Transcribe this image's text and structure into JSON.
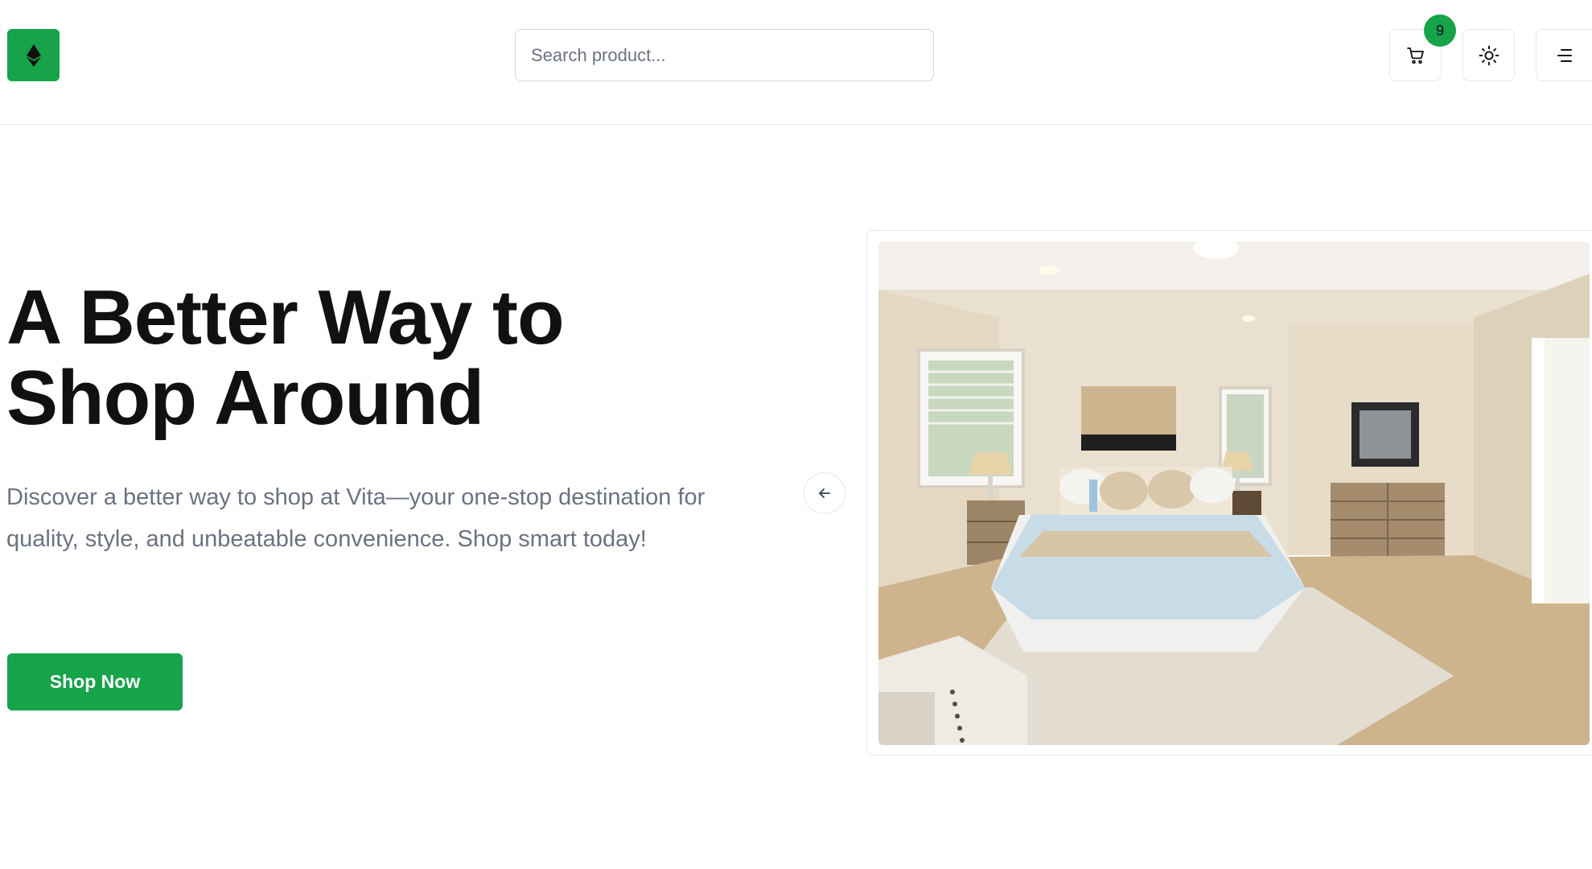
{
  "header": {
    "logo_icon": "ethereum-diamond-icon",
    "search_placeholder": "Search product...",
    "cart_icon": "cart-icon",
    "cart_count": "9",
    "theme_icon": "sun-icon",
    "menu_icon": "menu-icon"
  },
  "hero": {
    "title_line1": "A Better Way to",
    "title_line2": "Shop Around",
    "description": "Discover a better way to shop at Vita—your one-stop destination for quality, style, and unbeatable convenience. Shop smart today!",
    "cta_label": "Shop Now"
  },
  "carousel": {
    "prev_icon": "arrow-left-icon",
    "slide_image": "bedroom-photo"
  },
  "colors": {
    "accent": "#16a34a",
    "text": "#111111",
    "muted": "#6b7280",
    "border": "#e5e7eb"
  }
}
